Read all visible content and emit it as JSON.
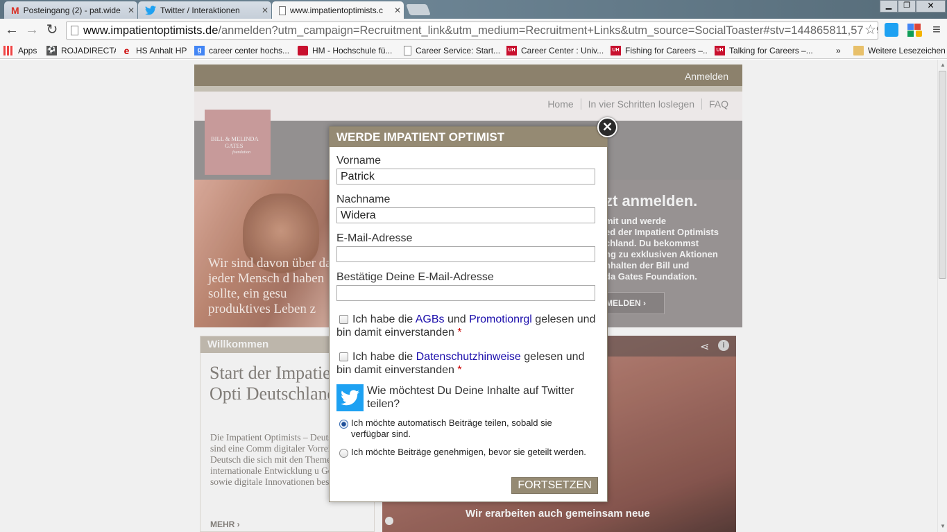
{
  "browser": {
    "tabs": [
      {
        "label": "Posteingang (2) - pat.wide",
        "icon": "gmail-icon"
      },
      {
        "label": "Twitter / Interaktionen",
        "icon": "twitter-icon"
      },
      {
        "label": "www.impatientoptimists.c",
        "icon": "page-icon"
      }
    ],
    "url_host": "www.impatientoptimists.de",
    "url_path": "/anmelden?utm_campaign=Recruitment_link&utm_medium=Recruitment+Links&utm_source=SocialToaster#stv=144865811,57659",
    "bookmarks": [
      {
        "label": "Apps"
      },
      {
        "label": "ROJADIRECTA"
      },
      {
        "label": "HS Anhalt HP"
      },
      {
        "label": "career center hochs..."
      },
      {
        "label": "HM - Hochschule fü..."
      },
      {
        "label": "Career Service: Start..."
      },
      {
        "label": "Career Center : Univ..."
      },
      {
        "label": "Fishing for Careers –..."
      },
      {
        "label": "Talking for Careers –..."
      }
    ],
    "bookmarks_more": "»",
    "other_bookmarks": "Weitere Lesezeichen"
  },
  "site": {
    "login_label": "Anmelden",
    "nav": [
      "Home",
      "In vier Schritten loslegen",
      "FAQ"
    ],
    "logo_line1": "BILL & MELINDA",
    "logo_line2": "GATES",
    "logo_line3": "foundation",
    "hero_quote": "Wir sind davon über dass jeder Mensch d haben sollte, ein gesu produktives Leben z",
    "hero_heading": "zt anmelden.",
    "hero_text": "mit und werde\ned der Impatient Optimists\nchland. Du bekommst\nng zu exklusiven Aktionen\nnhalten der Bill und\nda Gates Foundation.",
    "hero_button": "MELDEN",
    "welcome_title": "Willkommen",
    "welcome_heading": "Start der Impatient Opti Deutschland.",
    "welcome_text": "Die Impatient Optimists – Deutschland sind eine Comm digitaler Vorreiter in Deutsch die sich mit den Themen internationale Entwicklung u Gesundheit sowie digitale Innovationen beschäftigen.",
    "more_link": "MEHR",
    "video_caption": "Wir erarbeiten auch gemeinsam neue"
  },
  "modal": {
    "title": "WERDE IMPATIENT OPTIMIST",
    "first_name_label": "Vorname",
    "first_name_value": "Patrick",
    "last_name_label": "Nachname",
    "last_name_value": "Widera",
    "email_label": "E-Mail-Adresse",
    "email_value": "",
    "email_confirm_label": "Bestätige Deine E-Mail-Adresse",
    "email_confirm_value": "",
    "terms_pre": "Ich habe die ",
    "terms_link1": "AGBs",
    "terms_mid": " und ",
    "terms_link2": "Promotionrgl",
    "terms_post": " gelesen und bin damit einverstanden",
    "privacy_pre": "Ich habe die ",
    "privacy_link": "Datenschutzhinweise",
    "privacy_post": " gelesen und bin damit einverstanden",
    "required_mark": "*",
    "twitter_question": "Wie möchtest Du Deine Inhalte auf Twitter teilen?",
    "option_auto": "Ich möchte automatisch Beiträge teilen, sobald sie verfügbar sind.",
    "option_approve": "Ich möchte Beiträge genehmigen, bevor sie geteilt werden.",
    "selected_option": "auto",
    "submit_label": "FORTSETZEN"
  },
  "colors": {
    "brand_taupe": "#958a73",
    "link": "#1a0dab",
    "twitter": "#1da1f2",
    "required": "#c00"
  }
}
